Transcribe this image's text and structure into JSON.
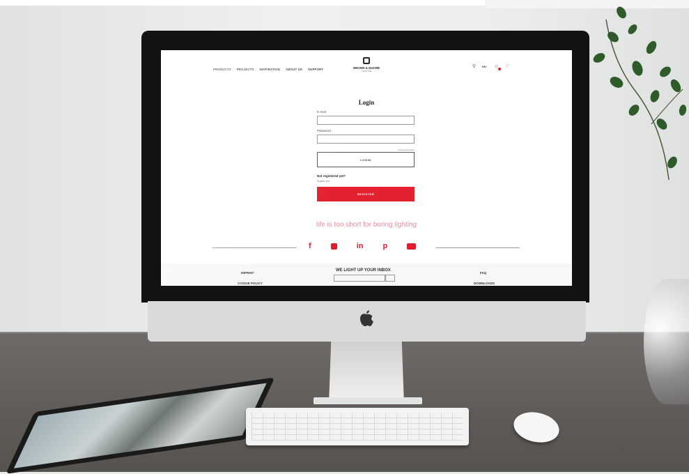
{
  "nav": {
    "items": [
      "PRODUCTS",
      "PROJECTS",
      "INSPIRATION",
      "ABOUT US",
      "SUPPORT"
    ]
  },
  "brand": {
    "name": "WEVER & DUCRÉ",
    "sub": "LIGHTING"
  },
  "header": {
    "lang": "EN ·"
  },
  "login": {
    "title": "Login",
    "email_label": "E-mail",
    "password_label": "Password",
    "forgot": "Forgot password?",
    "button": "LOGIN",
    "not_registered": "Not registered yet?",
    "register_free": "Register free",
    "register_button": "REGISTER"
  },
  "tagline": {
    "text": "life is too short for boring ",
    "emph": "lighting"
  },
  "social": {
    "facebook": "f",
    "linkedin": "in",
    "pinterest": "p"
  },
  "footer": {
    "imprint": "IMPRINT",
    "cookie": "COOKIE POLICY",
    "newsletter": "WE LIGHT UP YOUR INBOX",
    "faq": "FAQ",
    "download": "DOWNLOADS"
  },
  "colors": {
    "accent": "#e4222f",
    "tagline": "#f08a9a"
  }
}
